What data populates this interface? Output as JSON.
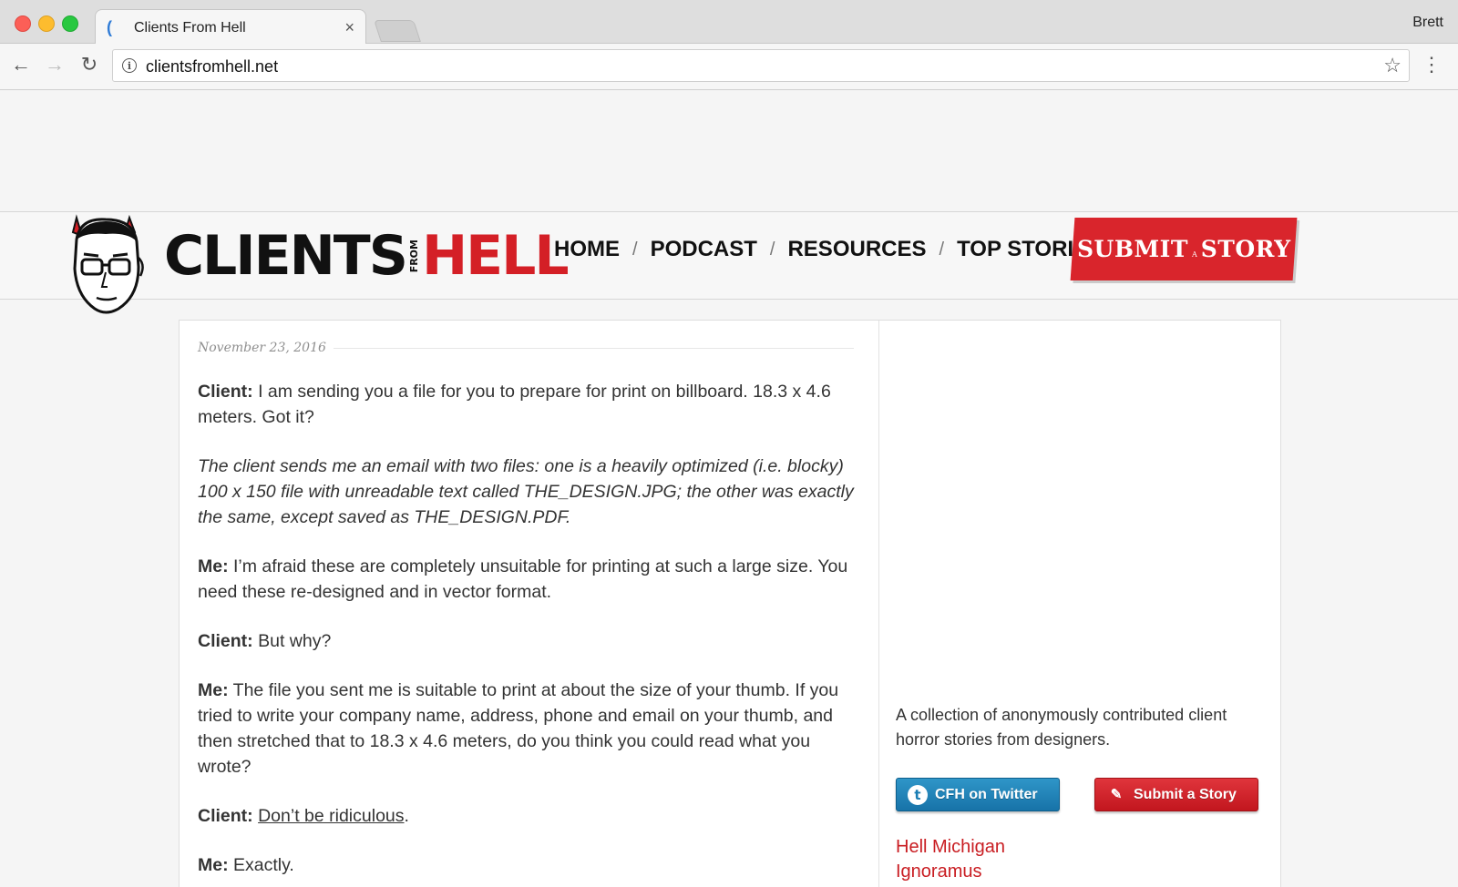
{
  "browser": {
    "tab_title": "Clients From Hell",
    "tab_close": "×",
    "profile_name": "Brett",
    "url": "clientsfromhell.net",
    "icons": [
      "back-icon",
      "forward-icon",
      "reload-icon",
      "info-icon",
      "star-icon",
      "menu-icon"
    ]
  },
  "site": {
    "logo_left": "CLIENTS",
    "logo_from": "FROM",
    "logo_right": "HELL",
    "nav": [
      {
        "label": "HOME"
      },
      {
        "label": "PODCAST"
      },
      {
        "label": "RESOURCES"
      },
      {
        "label": "TOP STORIES"
      }
    ],
    "nav_separator": "/",
    "submit_banner": {
      "left": "SUBMIT",
      "middle": "A",
      "right": "STORY"
    },
    "colors": {
      "brand_red": "#d41f26",
      "twitter_blue": "#1a7db3"
    }
  },
  "post": {
    "date": "November 23, 2016",
    "paragraphs": [
      {
        "speaker": "Client:",
        "text": " I am sending you a file for you to prepare for print on billboard. 18.3 x 4.6 meters. Got it?"
      },
      {
        "narration": "The client sends me an email with two files: one is a heavily optimized (i.e. blocky) 100 x 150 file with unreadable text called THE_DESIGN.JPG; the other was exactly the same, except saved as THE_DESIGN.PDF."
      },
      {
        "speaker": "Me:",
        "text": " I’m afraid these are completely unsuitable for printing at such a large size. You need these re-designed and in vector format."
      },
      {
        "speaker": "Client:",
        "text": " But why?"
      },
      {
        "speaker": "Me:",
        "text": " The file you sent me is suitable to print at about the size of your thumb. If you tried to write your company name, address, phone and email on your thumb, and then stretched that to 18.3 x 4.6 meters, do you think you could read what you wrote?"
      },
      {
        "speaker": "Client:",
        "link": "Don’t be ridiculous",
        "after": "."
      },
      {
        "speaker": "Me:",
        "text": " Exactly."
      }
    ]
  },
  "sidebar": {
    "blurb": "A collection of anonymously contributed client horror stories from designers.",
    "twitter_button": "CFH on Twitter",
    "submit_button": "Submit a Story",
    "links": [
      "Hell Michigan",
      "Ignoramus"
    ]
  }
}
